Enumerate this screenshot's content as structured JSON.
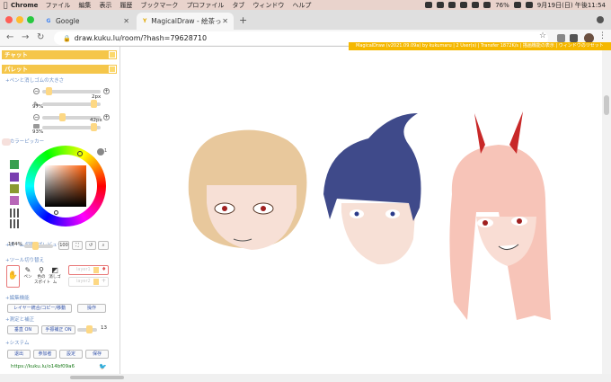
{
  "menubar": {
    "app": "Chrome",
    "items": [
      "ファイル",
      "編集",
      "表示",
      "履歴",
      "ブックマーク",
      "プロファイル",
      "タブ",
      "ウィンドウ",
      "ヘルプ"
    ],
    "battery": "76%",
    "clock": "9月19日(日) 午後11:54"
  },
  "tabs": [
    {
      "title": "Google",
      "favicon": "G"
    },
    {
      "title": "MagicalDraw - 絵茶ったんぞ",
      "favicon": "Y"
    }
  ],
  "address": {
    "url": "draw.kuku.lu/room/?hash=79628710"
  },
  "infobar": {
    "text": "MagicalDraw (v2021.09.09a) by kukumaru | 2 User(s) | Transfer 1872K/s | 描画機能の表示 | ウィンドウのリセット"
  },
  "sidebar": {
    "chat_header": "チャット",
    "palette_header": "パレット",
    "pen_section": "+ペンと消しゴムの大きさ",
    "pen_size": "2px",
    "pen_opacity": "97%",
    "eraser_size": "42px",
    "eraser_opacity": "93%",
    "color_section": "+カラーピッカー",
    "zoom_section": "+ズーム/回転/プレビュー",
    "zoom_value": "184%",
    "zoom_100": "100",
    "tool_section": "+ツール切り替え",
    "tools": [
      "ペン",
      "色の\nスポイト",
      "消しゴム"
    ],
    "layer1": "layer1",
    "layer2": "layer2",
    "edit_section": "+編集機能",
    "layer_btn": "レイヤー統合/コピー/移動",
    "op_btn": "操作",
    "correction_section": "+測定と補正",
    "correction_on": "垂直 ON",
    "correction_hand": "手振補正 ON",
    "correction_value": "13",
    "system_section": "+システム",
    "sys_buttons": [
      "退出",
      "参加者",
      "設定",
      "保存"
    ],
    "share_url": "https://kuku.lu/o14bf09a6"
  },
  "colors": {
    "accent": "#f5c64a",
    "swatches": [
      "#3aa050",
      "#7a3fb0",
      "#8a9a30",
      "#b866b8"
    ]
  }
}
